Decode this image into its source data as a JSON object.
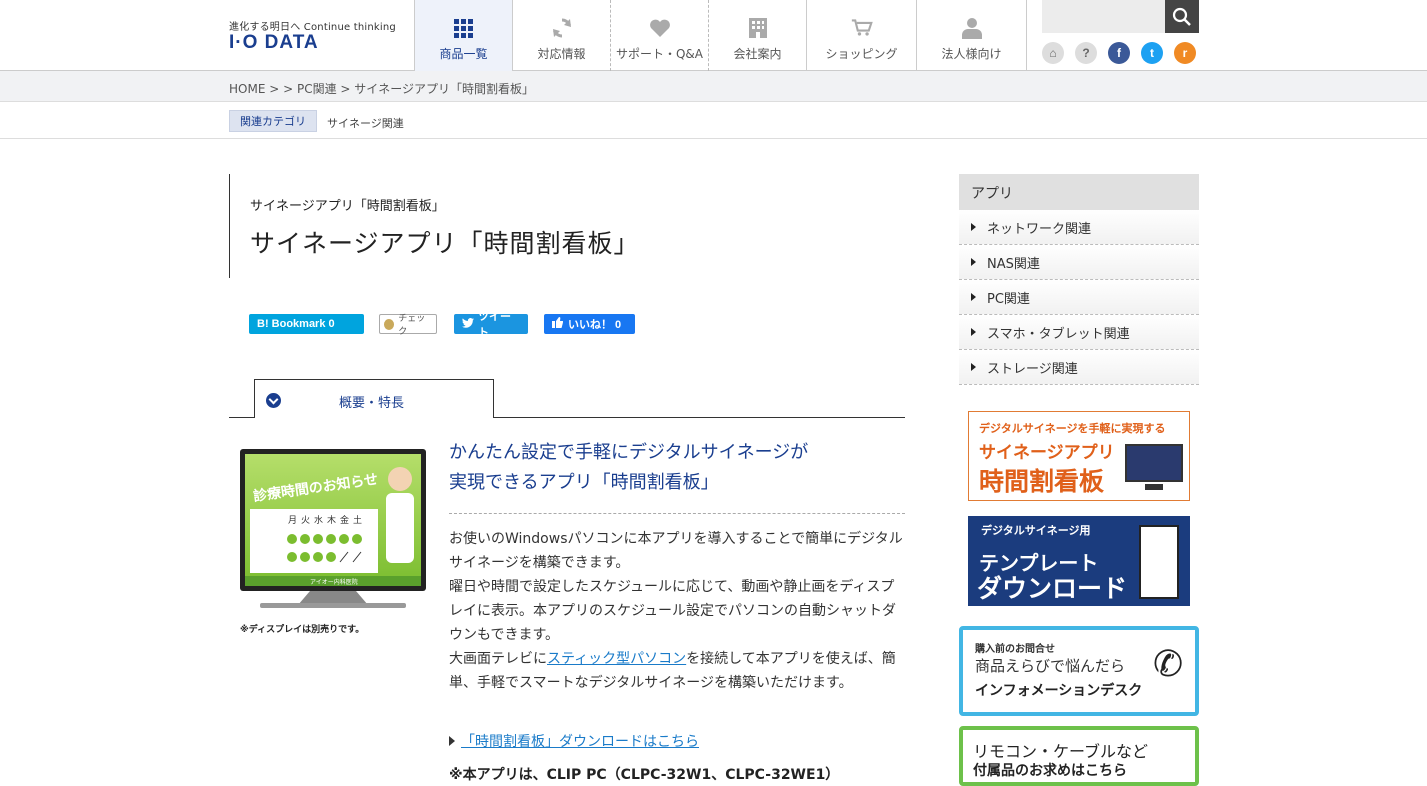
{
  "header": {
    "tagline": "進化する明日へ Continue thinking",
    "logo": "I·O DATA",
    "nav": [
      {
        "label": "商品一覧",
        "icon": "grid-icon"
      },
      {
        "label": "対応情報",
        "icon": "refresh-icon"
      },
      {
        "label": "サポート・Q&A",
        "icon": "heart-icon"
      },
      {
        "label": "会社案内",
        "icon": "building-icon"
      },
      {
        "label": "ショッピング",
        "icon": "cart-icon"
      },
      {
        "label": "法人様向け",
        "icon": "person-icon"
      }
    ],
    "search_placeholder": "",
    "util_icons": [
      "sitemap-icon",
      "help-icon",
      "facebook-icon",
      "twitter-icon",
      "rss-icon"
    ],
    "util_glyphs": [
      "⌂",
      "?",
      "f",
      "t",
      "r"
    ]
  },
  "breadcrumb": "HOME > > PC関連 > サイネージアプリ「時間割看板」",
  "category": {
    "tag": "関連カテゴリ",
    "link": "サイネージ関連"
  },
  "title": {
    "small": "サイネージアプリ「時間割看板」",
    "big": "サイネージアプリ「時間割看板」"
  },
  "social": {
    "hatena": "B! Bookmark  0",
    "mixi": "チェック",
    "tweet": "ツイート",
    "like": "いいね！ 0"
  },
  "tab": {
    "label": "概要・特長"
  },
  "product_image": {
    "heading": "診療時間のお知らせ",
    "days": [
      "月",
      "火",
      "水",
      "木",
      "金",
      "土"
    ],
    "footer": "アイオー内科医院",
    "note": "※ディスプレイは別売りです。"
  },
  "content": {
    "lead_line1": "かんたん設定で手軽にデジタルサイネージが",
    "lead_line2": "実現できるアプリ「時間割看板」",
    "body1": "お使いのWindowsパソコンに本アプリを導入することで簡単にデジタルサイネージを構築できます。",
    "body2": "曜日や時間で設定したスケジュールに応じて、動画や静止画をディスプレイに表示。本アプリのスケジュール設定でパソコンの自動シャットダウンもできます。",
    "body3_pre": "大画面テレビに",
    "body3_link": "スティック型パソコン",
    "body3_post": "を接続して本アプリを使えば、簡単、手軽でスマートなデジタルサイネージを構築いただけます。",
    "download_link": "「時間割看板」ダウンロードはこちら",
    "note": "※本アプリは、CLIP PC（CLPC-32W1、CLPC-32WE1）"
  },
  "sidebar": {
    "head": "アプリ",
    "items": [
      "ネットワーク関連",
      "NAS関連",
      "PC関連",
      "スマホ・タブレット関連",
      "ストレージ関連"
    ]
  },
  "banners": {
    "b1_top": "デジタルサイネージを手軽に実現する",
    "b1_mid": "サイネージアプリ",
    "b1_big": "時間割看板",
    "b2_top": "デジタルサイネージ用",
    "b2_mid": "テンプレート",
    "b2_big": "ダウンロード",
    "b3_top": "購入前のお問合せ",
    "b3_mid": "商品えらびで悩んだら",
    "b3_big": "インフォメーションデスク",
    "b4_mid": "リモコン・ケーブルなど",
    "b4_big": "付属品のお求めはこちら"
  }
}
